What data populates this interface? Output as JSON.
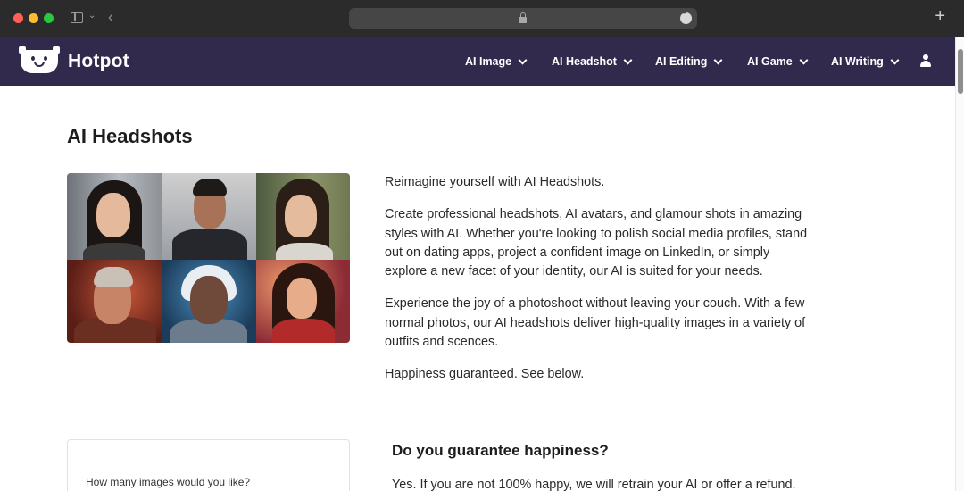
{
  "browser": {
    "icons": [
      "sidebar-toggle-icon",
      "chevron-down-icon",
      "back-icon",
      "lock-icon",
      "more-icon",
      "plus-icon"
    ]
  },
  "nav": {
    "logo_text": "Hotpot",
    "items": [
      {
        "label": "AI Image"
      },
      {
        "label": "AI Headshot"
      },
      {
        "label": "AI Editing"
      },
      {
        "label": "AI Game"
      },
      {
        "label": "AI Writing"
      }
    ],
    "brand_color": "#312a4d"
  },
  "main": {
    "title": "AI Headshots",
    "paragraphs": [
      "Reimagine yourself with AI Headshots.",
      "Create professional headshots, AI avatars, and glamour shots in amazing styles with AI. Whether you're looking to polish social media profiles, stand out on dating apps, project a confident image on LinkedIn, or simply explore a new facet of your identity, our AI is suited for your needs.",
      "Experience the joy of a photoshoot without leaving your couch. With a few normal photos, our AI headshots deliver high-quality images in a variety of outfits and scences.",
      "Happiness guaranteed. See below."
    ]
  },
  "order": {
    "question": "How many images would you like?"
  },
  "faq": {
    "heading": "Do you guarantee happiness?",
    "answer": "Yes. If you are not 100% happy, we will retrain your AI or offer a refund."
  }
}
